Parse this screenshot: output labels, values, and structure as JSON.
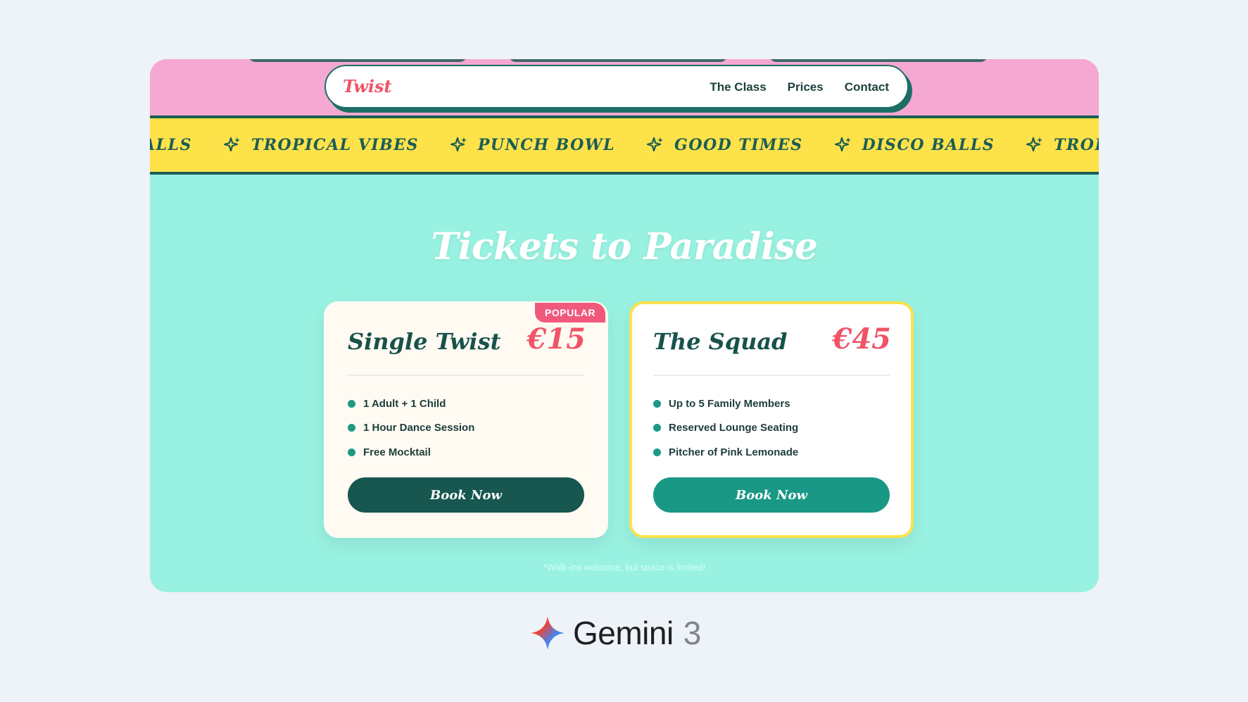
{
  "header": {
    "logo": "Twist",
    "nav": [
      "The Class",
      "Prices",
      "Contact"
    ]
  },
  "marquee": {
    "items": [
      "ALLS",
      "TROPICAL VIBES",
      "PUNCH BOWL",
      "GOOD TIMES",
      "DISCO BALLS",
      "TROPIC"
    ],
    "icon": "sparkle-icon"
  },
  "hero": {
    "title": "Tickets to Paradise"
  },
  "cards": [
    {
      "name": "Single Twist",
      "price": "€15",
      "badge": "POPULAR",
      "features": [
        "1 Adult + 1 Child",
        "1 Hour Dance Session",
        "Free Mocktail"
      ],
      "button": "Book Now"
    },
    {
      "name": "The Squad",
      "price": "€45",
      "features": [
        "Up to 5 Family Members",
        "Reserved Lounge Seating",
        "Pitcher of Pink Lemonade"
      ],
      "button": "Book Now"
    }
  ],
  "footnote": "*Walk-ins welcome, but space is limited!",
  "brand": {
    "name": "Gemini",
    "version": "3"
  },
  "colors": {
    "pink_header": "#f5a8d2",
    "marquee_yellow": "#fde24a",
    "mint_bg": "#99f2e1",
    "dark_teal": "#17524b",
    "coral": "#ef5467",
    "teal_button": "#1a9886"
  }
}
